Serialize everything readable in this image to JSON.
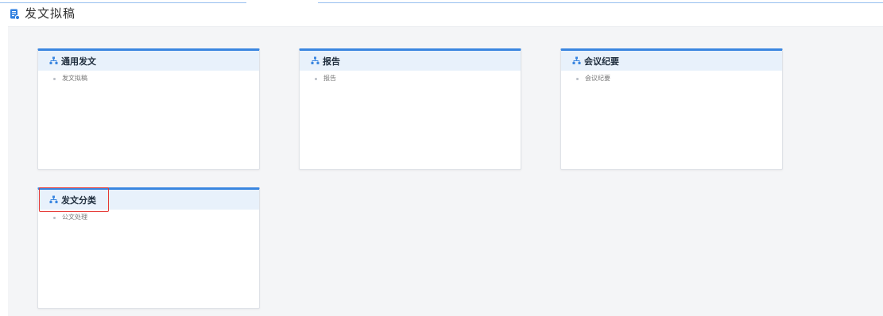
{
  "header": {
    "title": "发文拟稿",
    "icon": "document-icon"
  },
  "accent_color": "#3a86e0",
  "highlight_color": "#e53935",
  "cards": [
    {
      "title": "通用发文",
      "items": [
        "发文拟稿"
      ]
    },
    {
      "title": "报告",
      "items": [
        "报告"
      ]
    },
    {
      "title": "会议纪要",
      "items": [
        "会议纪要"
      ]
    },
    {
      "title": "发文分类",
      "items": [
        "公文处理"
      ]
    }
  ]
}
